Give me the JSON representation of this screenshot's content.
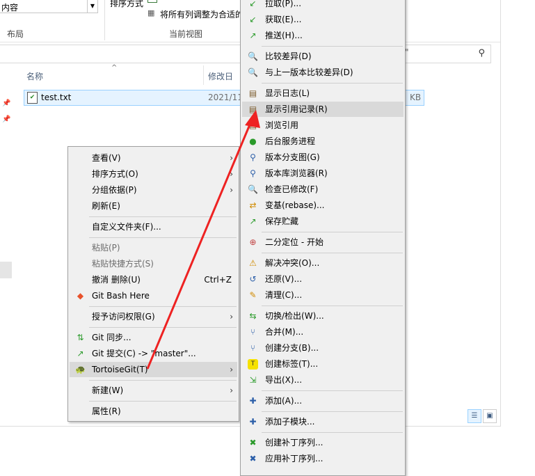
{
  "ribbon": {
    "layout_combo": "内容",
    "layout_group": "布局",
    "sort_label": "排序方式",
    "fit_columns": "将所有列调整为合适的",
    "current_view_group": "当前视图"
  },
  "columns": {
    "name": "名称",
    "modified": "修改日"
  },
  "file": {
    "name": "test.txt",
    "date": "2021/11",
    "size": "KB"
  },
  "search": {
    "suffix": "\""
  },
  "context_menu": {
    "view": "查看(V)",
    "sort": "排序方式(O)",
    "group": "分组依据(P)",
    "refresh": "刷新(E)",
    "customize": "自定义文件夹(F)...",
    "paste": "粘贴(P)",
    "paste_shortcut": "粘贴快捷方式(S)",
    "undo_delete": "撤消 删除(U)",
    "undo_shortcut": "Ctrl+Z",
    "git_bash": "Git Bash Here",
    "grant_access": "授予访问权限(G)",
    "git_sync": "Git 同步...",
    "git_commit": "Git 提交(C) -> \"master\"...",
    "tortoisegit": "TortoiseGit(T)",
    "new": "新建(W)",
    "properties": "属性(R)"
  },
  "tortoise_menu": {
    "pull": "拉取(P)...",
    "fetch": "获取(E)...",
    "push": "推送(H)...",
    "diff": "比较差异(D)",
    "diff_prev": "与上一版本比较差异(D)",
    "show_log": "显示日志(L)",
    "show_reflog": "显示引用记录(R)",
    "browse_refs": "浏览引用",
    "daemon": "后台服务进程",
    "revision_graph": "版本分支图(G)",
    "repo_browser": "版本库浏览器(R)",
    "check_mods": "检查已修改(F)",
    "rebase": "变基(rebase)...",
    "stash": "保存贮藏",
    "bisect": "二分定位 - 开始",
    "resolve": "解决冲突(O)...",
    "revert": "还原(V)...",
    "cleanup": "清理(C)...",
    "switch": "切换/检出(W)...",
    "merge": "合并(M)...",
    "branch": "创建分支(B)...",
    "tag": "创建标签(T)...",
    "export": "导出(X)...",
    "add": "添加(A)...",
    "submodule": "添加子模块...",
    "create_patch": "创建补丁序列...",
    "apply_patch": "应用补丁序列..."
  },
  "colors": {
    "arrow": "#ee2222",
    "highlight": "#d9d9d9",
    "menu_bg": "#f0f0f0"
  }
}
